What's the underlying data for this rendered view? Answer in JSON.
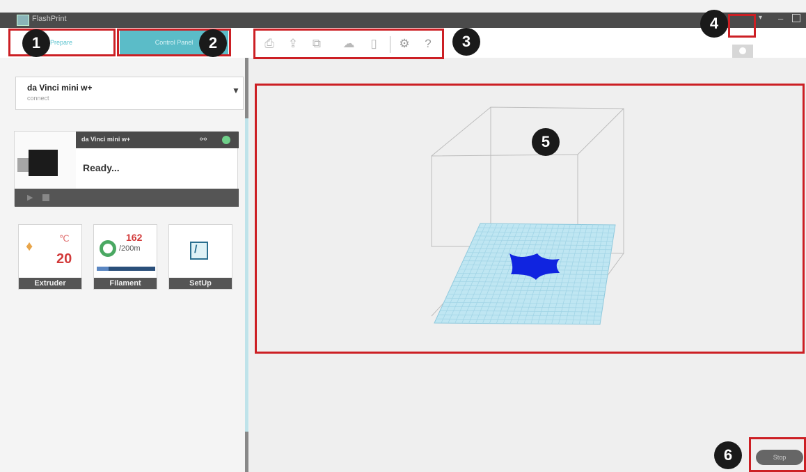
{
  "window": {
    "title": "FlashPrint",
    "controls": [
      "minimize-icon",
      "maximize-icon"
    ]
  },
  "tabs": [
    {
      "label": "Prepare"
    },
    {
      "label": "Control Panel"
    }
  ],
  "toolbar": {
    "icons": [
      "print-icon",
      "upload-icon",
      "preview-icon",
      "cloud-icon",
      "delete-icon",
      "settings-icon",
      "help-icon"
    ]
  },
  "printer_select": {
    "name": "da Vinci mini w+",
    "connection": "connect"
  },
  "printer_card": {
    "model": "da Vinci mini w+",
    "status": "Ready..."
  },
  "tiles": {
    "extruder": {
      "label": "Extruder",
      "unit": "℃",
      "temperature": "20"
    },
    "filament": {
      "label": "Filament",
      "used": "162",
      "total": "/200m",
      "progress": 0.2
    },
    "setup": {
      "label": "SetUp"
    }
  },
  "viewport": {
    "object_color": "#1024e0",
    "grid_color": "#bfe6f2"
  },
  "stop_button": {
    "label": "Stop"
  },
  "annotations": [
    "1",
    "2",
    "3",
    "4",
    "5",
    "6"
  ]
}
